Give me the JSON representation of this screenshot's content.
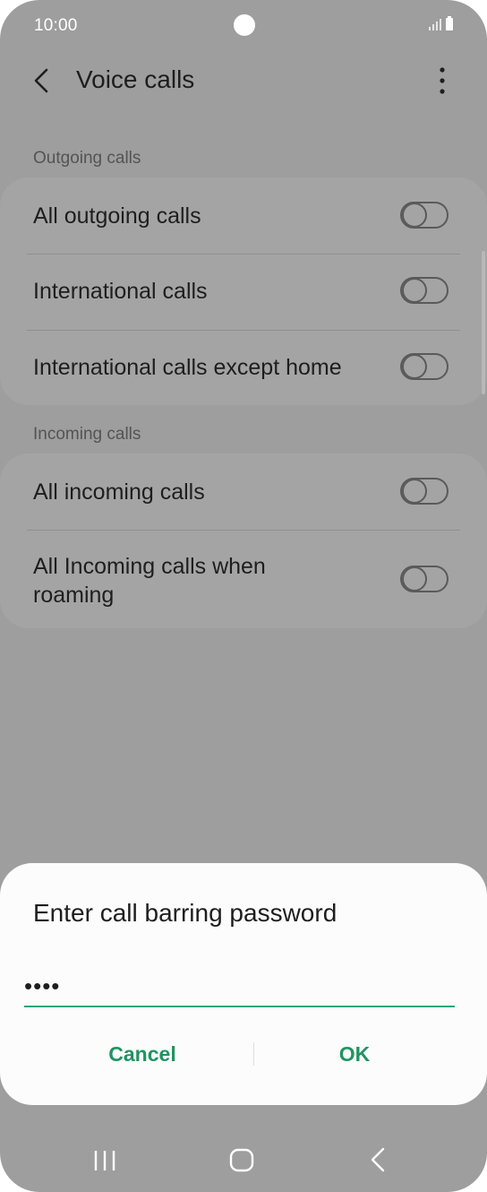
{
  "status_bar": {
    "time": "10:00",
    "signal_icon": "signal-icon",
    "battery_icon": "battery-icon"
  },
  "app_bar": {
    "title": "Voice calls",
    "back_icon": "back-arrow-icon",
    "more_icon": "more-options-icon"
  },
  "sections": [
    {
      "header": "Outgoing calls",
      "items": [
        {
          "label": "All outgoing calls",
          "enabled": false
        },
        {
          "label": "International calls",
          "enabled": false
        },
        {
          "label": "International calls except home",
          "enabled": false
        }
      ]
    },
    {
      "header": "Incoming calls",
      "items": [
        {
          "label": "All incoming calls",
          "enabled": false
        },
        {
          "label_line1": "All Incoming calls when",
          "label_line2": "roaming",
          "enabled": false
        }
      ]
    }
  ],
  "dialog": {
    "title": "Enter call barring password",
    "password_value": "••••",
    "cancel_label": "Cancel",
    "ok_label": "OK",
    "accent_color": "#1f9462"
  },
  "nav_bar": {
    "recents_icon": "recents-icon",
    "home_icon": "home-icon",
    "back_icon": "nav-back-icon"
  }
}
